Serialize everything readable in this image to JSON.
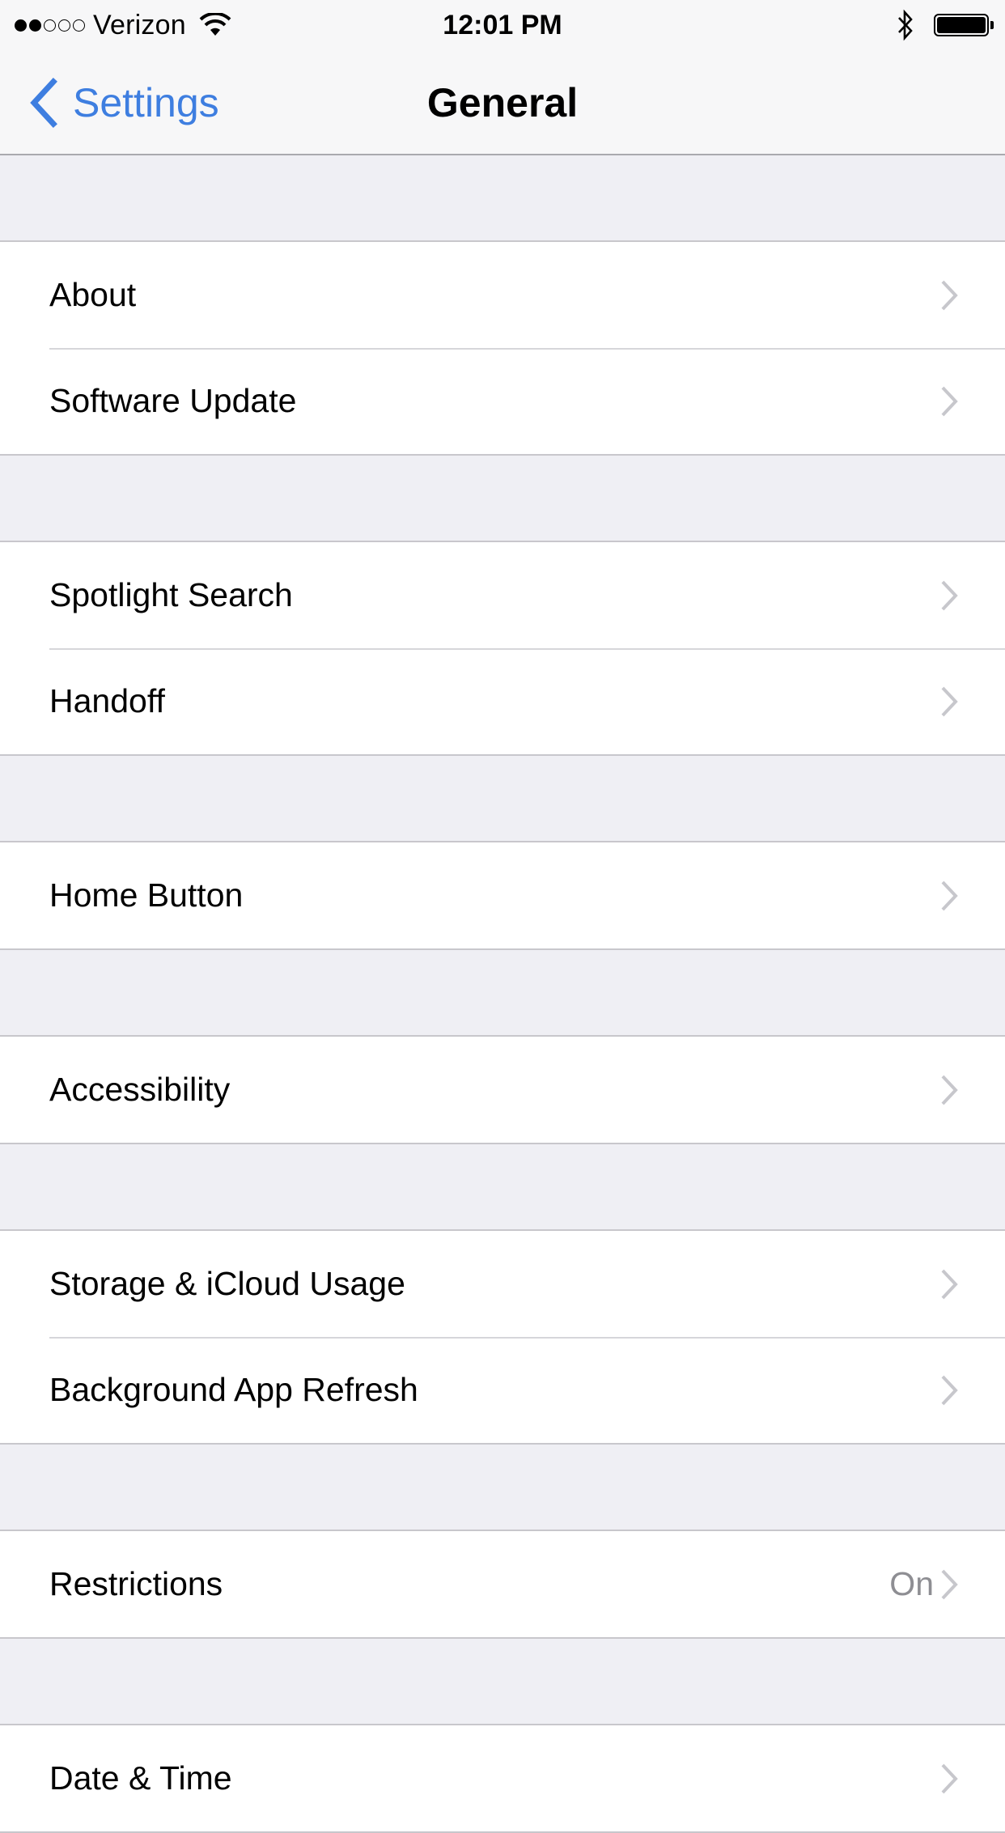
{
  "status_bar": {
    "signal_bars_filled": 2,
    "signal_bars_total": 5,
    "carrier": "Verizon",
    "wifi_icon": "wifi-icon",
    "time": "12:01 PM",
    "bluetooth_icon": "bluetooth-icon",
    "battery_level_percent": 100
  },
  "nav": {
    "back_label": "Settings",
    "title": "General"
  },
  "accent_color": "#3e7ee0",
  "sections": [
    {
      "rows": [
        {
          "label": "About",
          "value": ""
        },
        {
          "label": "Software Update",
          "value": ""
        }
      ]
    },
    {
      "rows": [
        {
          "label": "Spotlight Search",
          "value": ""
        },
        {
          "label": "Handoff",
          "value": ""
        }
      ]
    },
    {
      "rows": [
        {
          "label": "Home Button",
          "value": ""
        }
      ]
    },
    {
      "rows": [
        {
          "label": "Accessibility",
          "value": ""
        }
      ]
    },
    {
      "rows": [
        {
          "label": "Storage & iCloud Usage",
          "value": ""
        },
        {
          "label": "Background App Refresh",
          "value": ""
        }
      ]
    },
    {
      "rows": [
        {
          "label": "Restrictions",
          "value": "On"
        }
      ]
    },
    {
      "rows": [
        {
          "label": "Date & Time",
          "value": ""
        }
      ]
    }
  ]
}
